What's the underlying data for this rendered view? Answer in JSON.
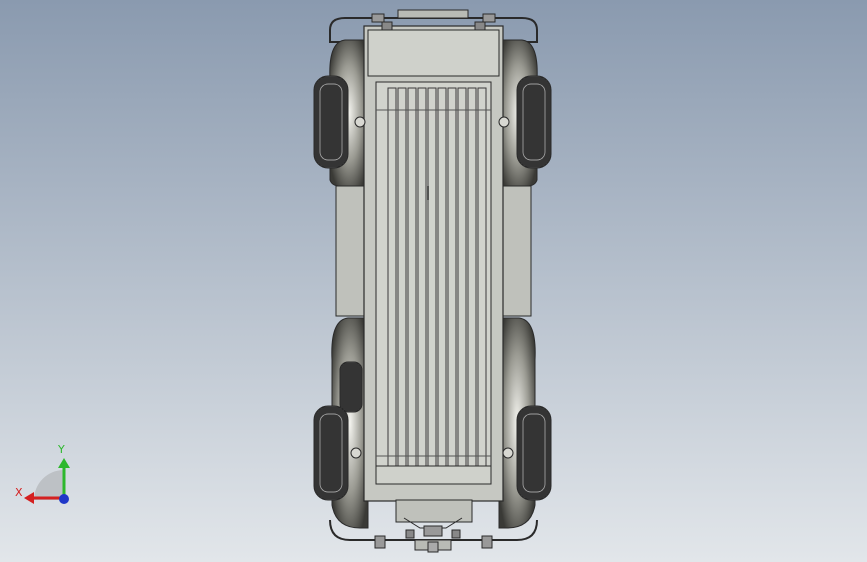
{
  "viewport": {
    "background_top": "#8a9aaf",
    "background_bottom": "#e2e6ea"
  },
  "triad": {
    "x_label": "X",
    "y_label": "Y",
    "x_color": "#d42020",
    "y_color": "#2db82d",
    "z_color": "#1f37c8"
  },
  "model": {
    "body_color": "#c6c8c2",
    "line_color": "#2a2a2a",
    "tire_color": "#222222"
  }
}
